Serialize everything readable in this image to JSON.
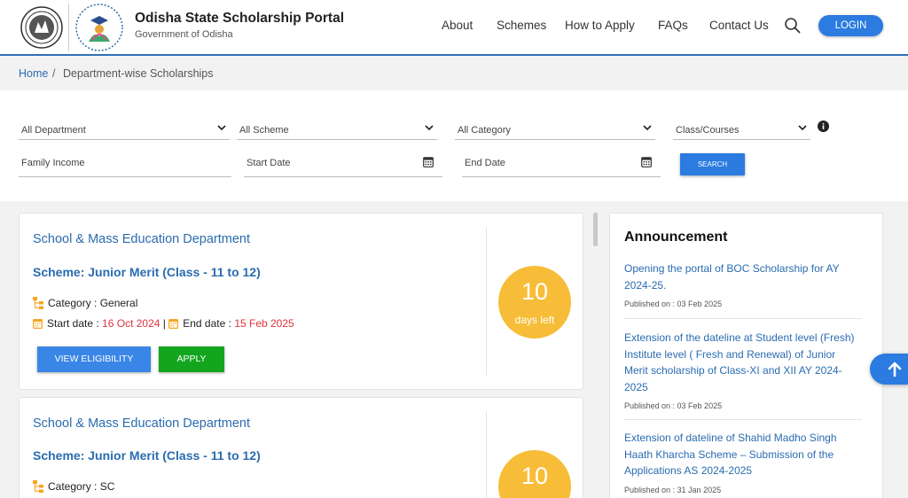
{
  "header": {
    "title": "Odisha State Scholarship Portal",
    "subtitle": "Government of Odisha",
    "nav": [
      "About",
      "Schemes",
      "How to Apply",
      "FAQs",
      "Contact Us"
    ],
    "login_label": "LOGIN",
    "colors": {
      "accent": "#2b7be0",
      "border": "#2f6fb7"
    }
  },
  "breadcrumb": {
    "home": "Home",
    "separator": "/",
    "current": "Department-wise Scholarships"
  },
  "filters": {
    "department": "All Department",
    "scheme": "All Scheme",
    "category": "All Category",
    "class": "Class/Courses",
    "family_income_placeholder": "Family Income",
    "start_date_placeholder": "Start Date",
    "end_date_placeholder": "End Date",
    "search_label": "SEARCH"
  },
  "cards": [
    {
      "department": "School & Mass Education Department",
      "scheme": "Scheme: Junior Merit (Class - 11 to 12)",
      "category": "Category : General",
      "start_label": "Start date :",
      "start_date": "16 Oct 2024",
      "separator": "|",
      "end_label": "End date :",
      "end_date": "15 Feb 2025",
      "days": "10",
      "days_label": "days left",
      "eligibility_label": "VIEW ELIGIBILITY",
      "apply_label": "APPLY"
    },
    {
      "department": "School & Mass Education Department",
      "scheme": "Scheme: Junior Merit (Class - 11 to 12)",
      "category": "Category : SC",
      "days": "10"
    }
  ],
  "announcement": {
    "title": "Announcement",
    "items": [
      {
        "text": "Opening the portal of BOC Scholarship for AY 2024-25.",
        "date": "Published on : 03 Feb 2025"
      },
      {
        "text": "Extension of the dateline at Student level (Fresh) Institute level ( Fresh and Renewal) of Junior Merit scholarship of Class-XI and XII AY 2024-2025",
        "date": "Published on : 03 Feb 2025"
      },
      {
        "text": "Extension of dateline of Shahid Madho Singh Haath Kharcha Scheme – Submission of  the Applications AS 2024-2025",
        "date": "Published on : 31 Jan 2025"
      }
    ]
  },
  "icons": {
    "search": "search-icon",
    "info": "info-icon",
    "calendar": "calendar-icon",
    "category": "category-tree-icon",
    "back_to_top": "arrow-up-icon"
  }
}
